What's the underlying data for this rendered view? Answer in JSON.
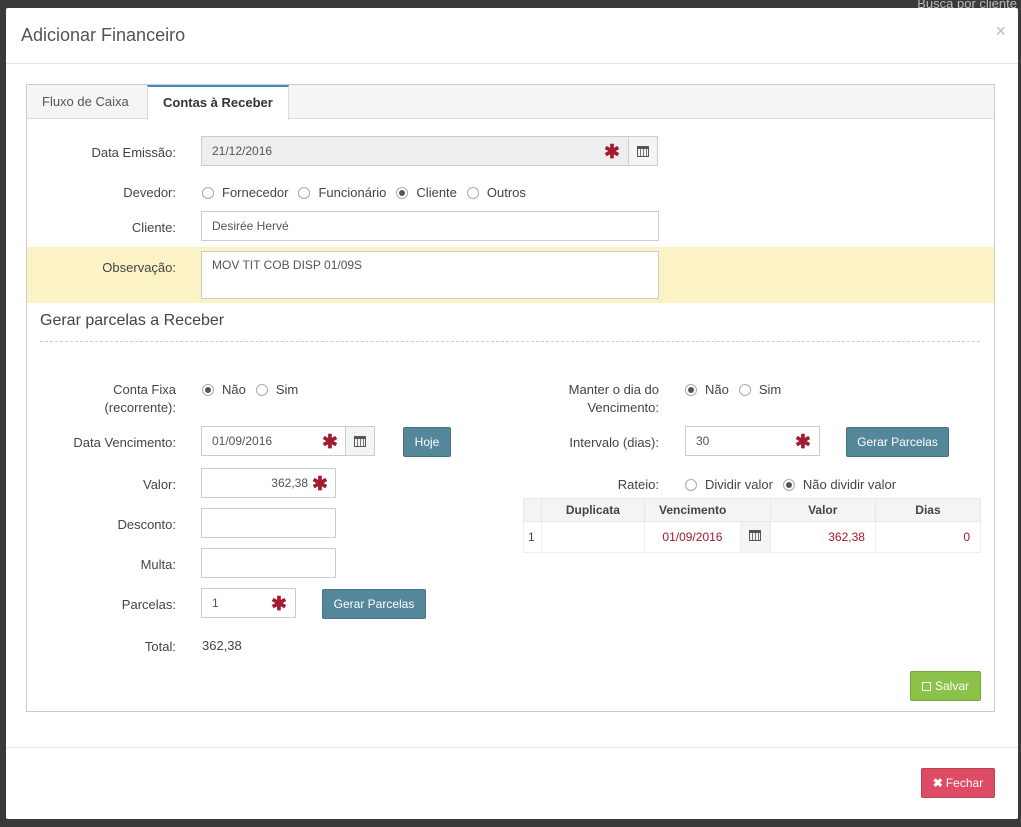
{
  "backdrop": {
    "search_hint": "Busca por cliente"
  },
  "modal": {
    "title": "Adicionar Financeiro",
    "close": "×"
  },
  "tabs": [
    "Fluxo de Caixa",
    "Contas à Receber"
  ],
  "form": {
    "data_emissao": {
      "label": "Data Emissão:",
      "value": "21/12/2016"
    },
    "devedor": {
      "label": "Devedor:",
      "options": [
        "Fornecedor",
        "Funcionário",
        "Cliente",
        "Outros"
      ],
      "selected": "Cliente"
    },
    "cliente": {
      "label": "Cliente:",
      "value": "Desirée Hervé"
    },
    "observacao": {
      "label": "Observação:",
      "value": "MOV TIT COB DISP  01/09S"
    }
  },
  "parcelas": {
    "title": "Gerar parcelas a Receber",
    "conta_fixa": {
      "label_1": "Conta Fixa",
      "label_2": "(recorrente):",
      "options": [
        "Não",
        "Sim"
      ],
      "selected": "Não"
    },
    "manter_dia": {
      "label_1": "Manter o dia do",
      "label_2": "Vencimento:",
      "options": [
        "Não",
        "Sim"
      ],
      "selected": "Não"
    },
    "data_vencimento": {
      "label": "Data Vencimento:",
      "value": "01/09/2016"
    },
    "hoje_button": "Hoje",
    "intervalo": {
      "label": "Intervalo (dias):",
      "value": "30"
    },
    "gerar_button": "Gerar Parcelas",
    "valor": {
      "label": "Valor:",
      "value": "362,38"
    },
    "rateio": {
      "label": "Rateio:",
      "options": [
        "Dividir valor",
        "Não dividir valor"
      ],
      "selected": "Não dividir valor"
    },
    "desconto": {
      "label": "Desconto:",
      "value": ""
    },
    "multa": {
      "label": "Multa:",
      "value": ""
    },
    "parcelas": {
      "label": "Parcelas:",
      "value": "1"
    },
    "total": {
      "label": "Total:",
      "value": "362,38"
    },
    "table": {
      "headers": [
        "",
        "Duplicata",
        "Vencimento",
        "",
        "Valor",
        "Dias"
      ],
      "rows": [
        {
          "idx": "1",
          "duplicata": "",
          "vencimento": "01/09/2016",
          "valor": "362,38",
          "dias": "0"
        }
      ]
    },
    "salvar_button": "Salvar"
  },
  "footer": {
    "fechar_button": "Fechar"
  },
  "colors": {
    "required_star": "#a31b2f",
    "blue_button": "#54879a",
    "green_button": "#8bc34a",
    "red_button": "#dd4b64",
    "highlight_row": "#fbf2c5"
  }
}
